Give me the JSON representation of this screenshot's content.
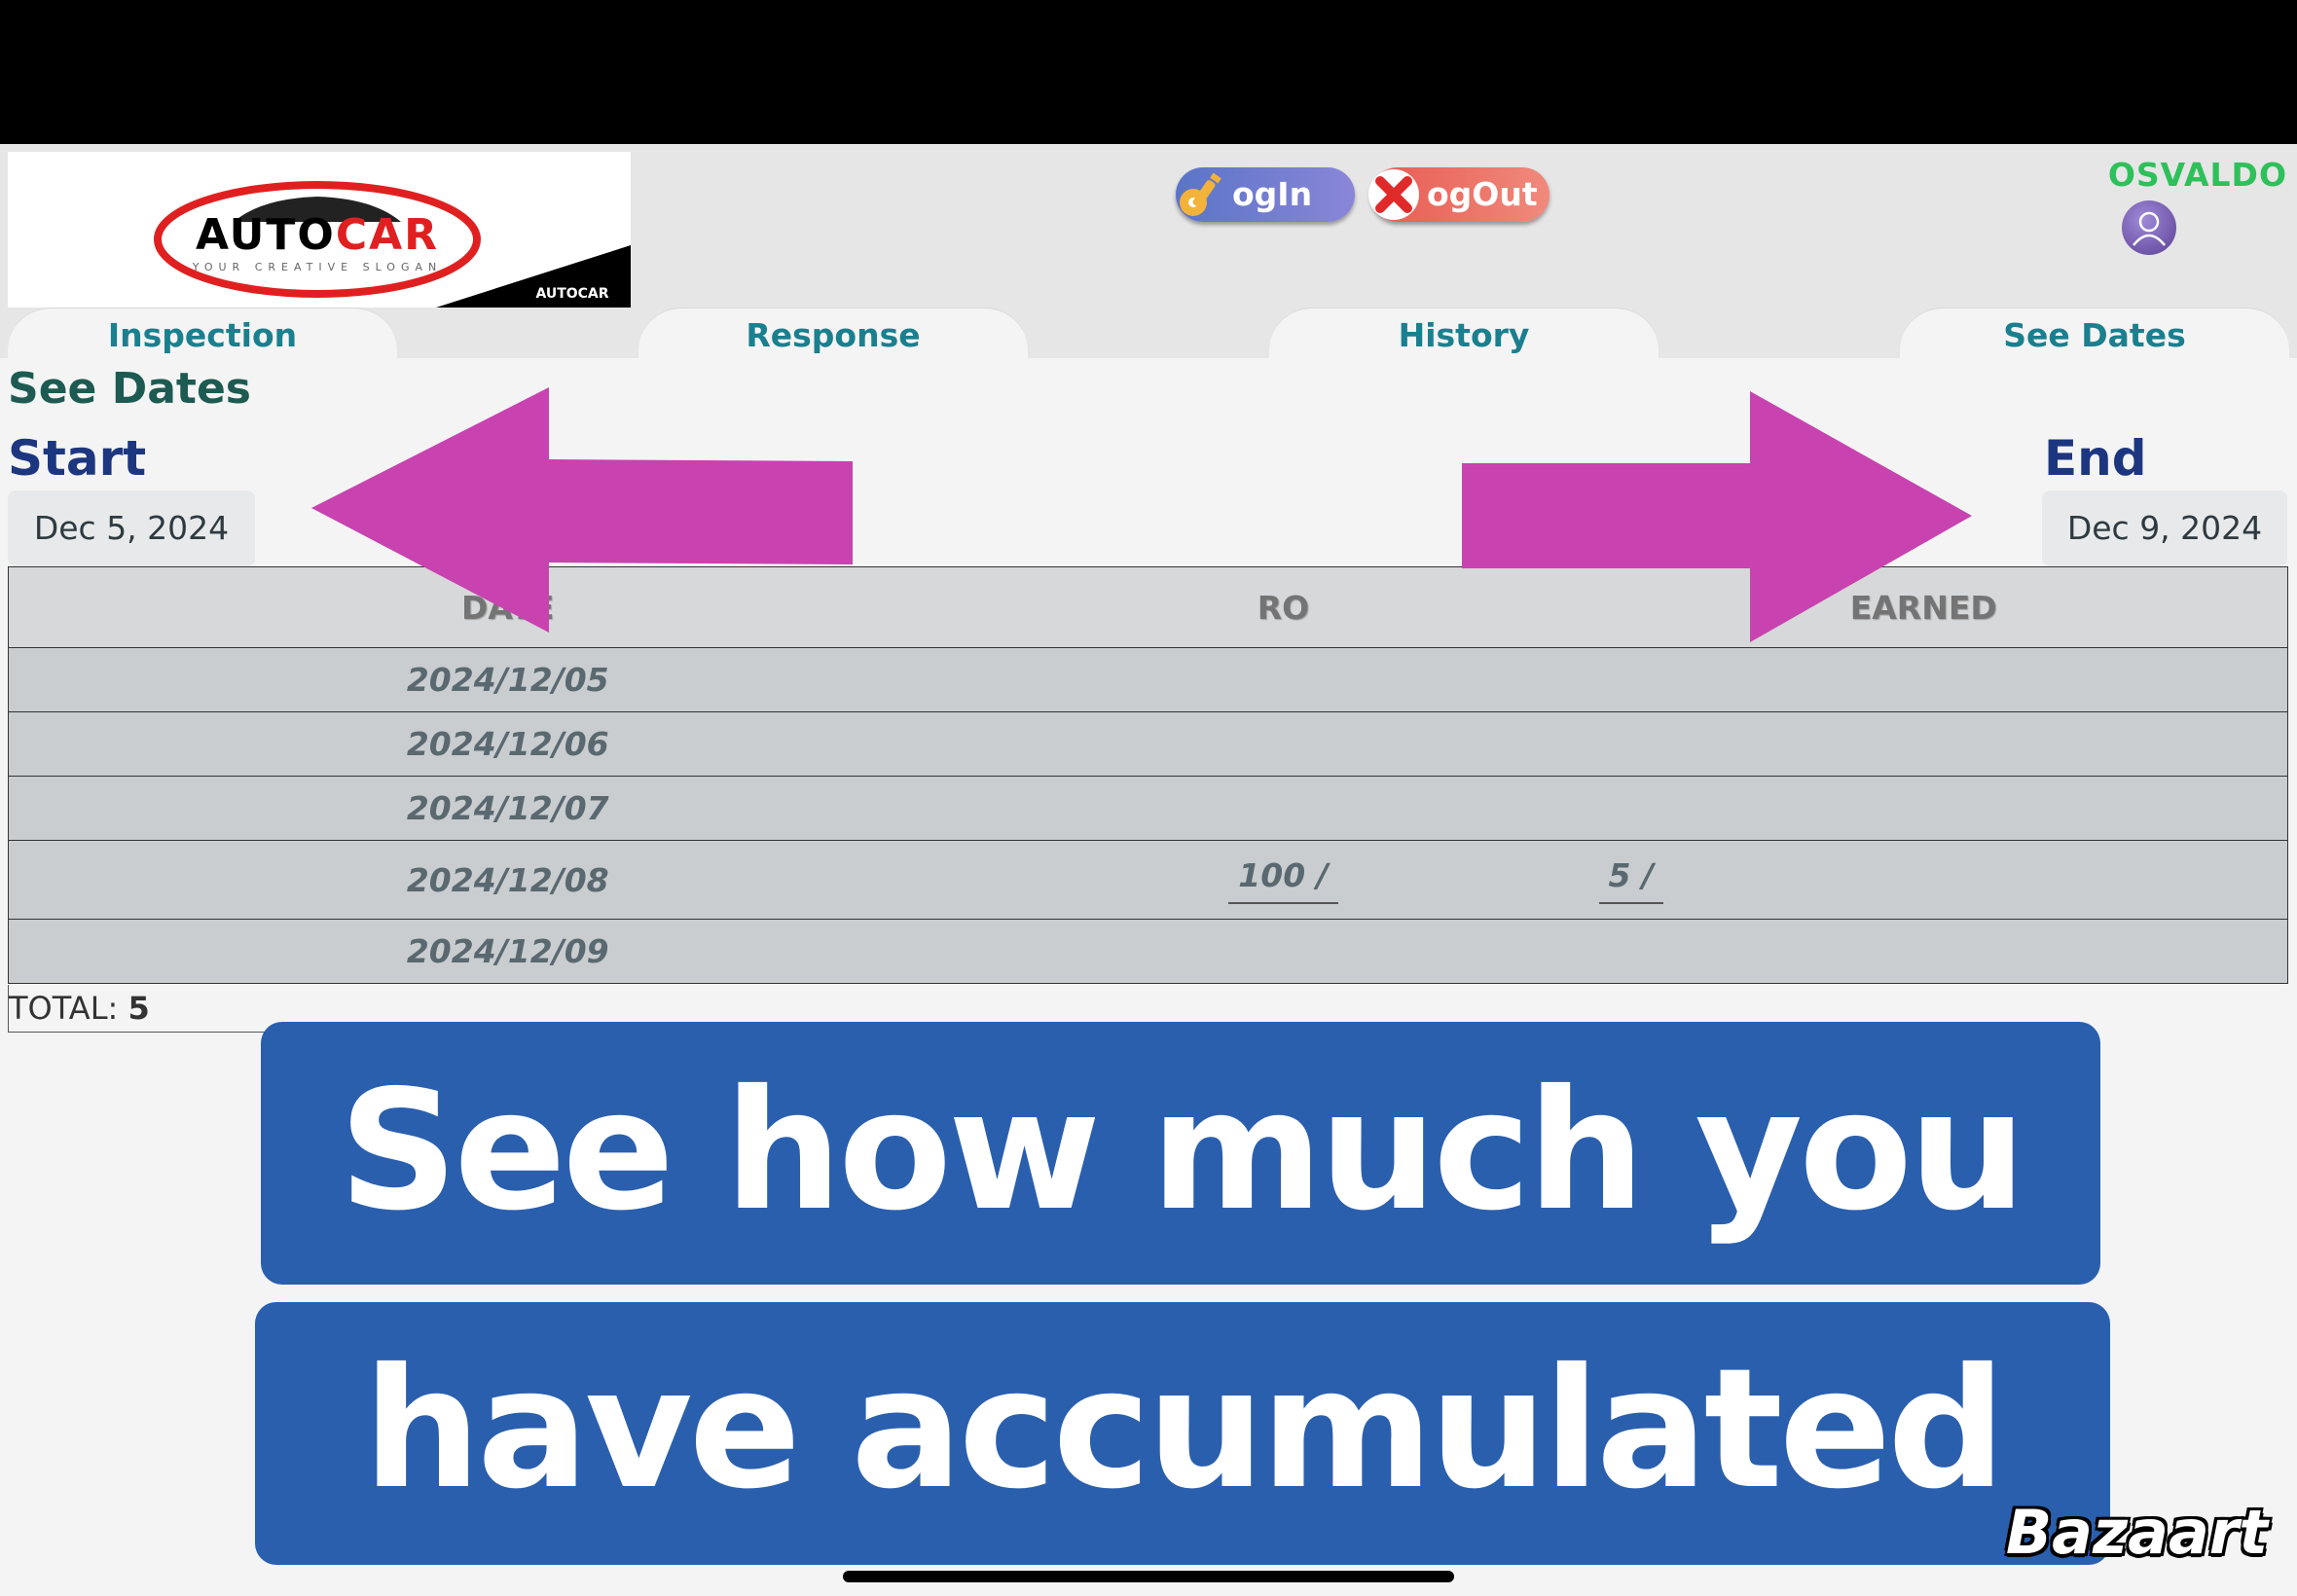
{
  "logo": {
    "name": "AUTOCAR",
    "name_part1": "AUTO",
    "name_part2": "CAR",
    "slogan": "YOUR CREATIVE SLOGAN"
  },
  "auth": {
    "login_label": "ogIn",
    "logout_label": "ogOut"
  },
  "user": {
    "name": "OSVALDO"
  },
  "tabs": [
    {
      "label": "Inspection"
    },
    {
      "label": "Response"
    },
    {
      "label": "History"
    },
    {
      "label": "See Dates"
    }
  ],
  "page": {
    "title": "See Dates",
    "start_label": "Start",
    "end_label": "End",
    "start_date": "Dec 5, 2024",
    "end_date": "Dec 9, 2024"
  },
  "table": {
    "headers": [
      "DATE",
      "RO",
      "EARNED"
    ],
    "rows": [
      {
        "date": "2024/12/05",
        "ro": "",
        "earned": ""
      },
      {
        "date": "2024/12/06",
        "ro": "",
        "earned": ""
      },
      {
        "date": "2024/12/07",
        "ro": "",
        "earned": ""
      },
      {
        "date": "2024/12/08",
        "ro": "100 /",
        "earned": "5 /"
      },
      {
        "date": "2024/12/09",
        "ro": "",
        "earned": ""
      }
    ],
    "total_label": "TOTAL:",
    "total_value": "5"
  },
  "overlay": {
    "line1": "See how much you",
    "line2": "have accumulated",
    "arrow_color": "#c842b0"
  },
  "watermark": "Bazaart",
  "colors": {
    "accent": "#1a7f8e",
    "title": "#1d3680",
    "banner": "#2a5fae",
    "username": "#2ec05a"
  }
}
